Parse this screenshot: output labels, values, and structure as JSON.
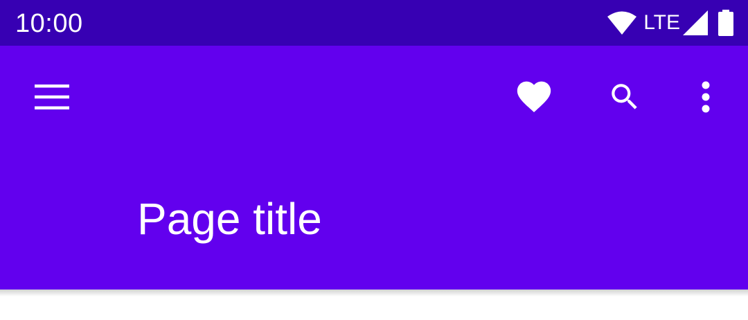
{
  "status_bar": {
    "time": "10:00",
    "network_label": "LTE",
    "icons": [
      "wifi-icon",
      "cellular-signal-icon",
      "battery-icon"
    ],
    "background_color": "#3700b3"
  },
  "app_bar": {
    "background_color": "#6200ee",
    "navigation_icon": "menu-icon",
    "actions": [
      "favorite-icon",
      "search-icon",
      "more-vert-icon"
    ],
    "title": "Page title"
  }
}
